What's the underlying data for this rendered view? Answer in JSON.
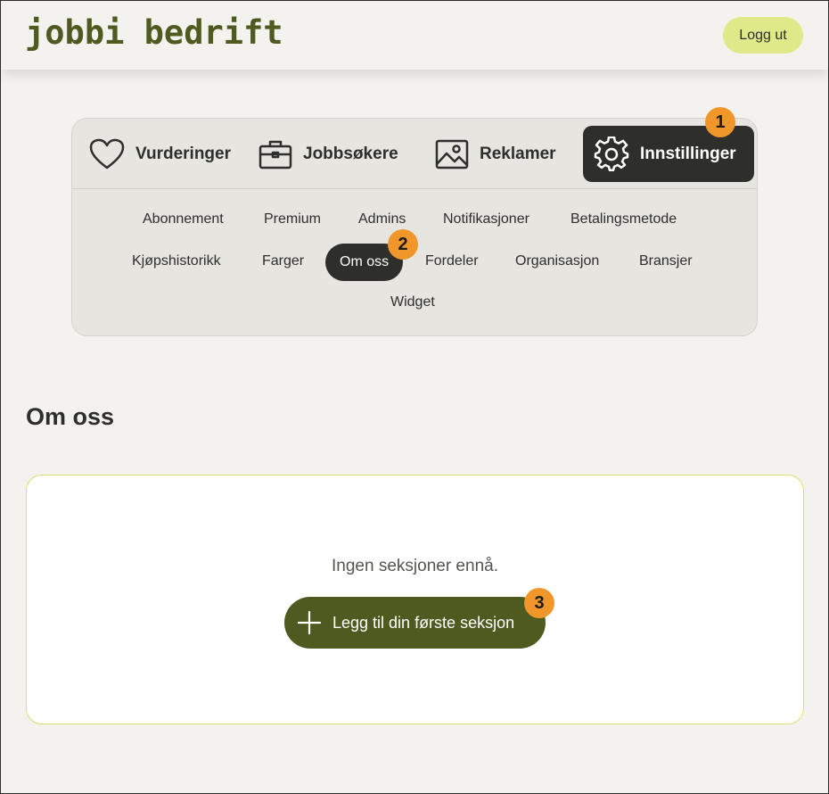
{
  "header": {
    "logo_text": "jobbi bedrift",
    "logout_label": "Logg ut"
  },
  "main_tabs": [
    {
      "label": "Vurderinger",
      "icon": "heart-icon"
    },
    {
      "label": "Jobbsøkere",
      "icon": "briefcase-icon"
    },
    {
      "label": "Reklamer",
      "icon": "image-icon"
    },
    {
      "label": "Innstillinger",
      "icon": "gear-icon",
      "active": true
    }
  ],
  "sub_nav": [
    "Abonnement",
    "Premium",
    "Admins",
    "Notifikasjoner",
    "Betalingsmetode",
    "Kjøpshistorikk",
    "Farger",
    "Om oss",
    "Fordeler",
    "Organisasjon",
    "Bransjer",
    "Widget"
  ],
  "sub_nav_active": "Om oss",
  "badges": [
    "1",
    "2",
    "3"
  ],
  "page": {
    "title": "Om oss",
    "empty_text": "Ingen seksjoner ennå.",
    "add_button_label": "Legg til din første seksjon"
  },
  "colors": {
    "brand_green": "#4e5a1f",
    "logout_bg": "#dfe98a",
    "active_dark": "#2e2e2b",
    "badge_orange": "#f0962b",
    "background": "#f3f2ee"
  }
}
